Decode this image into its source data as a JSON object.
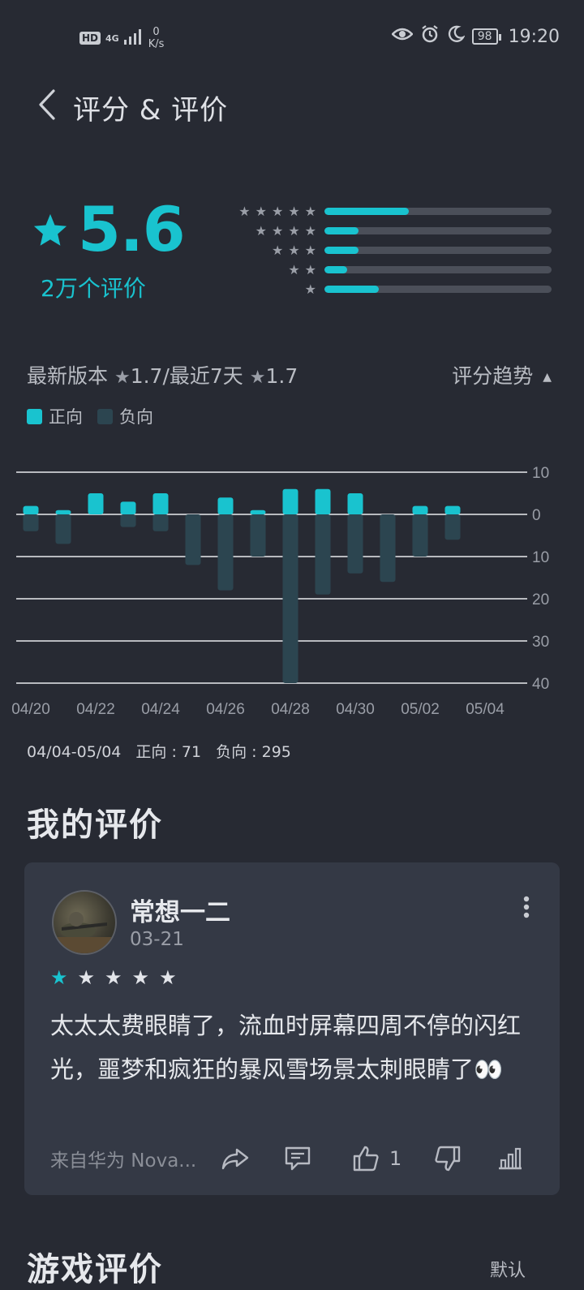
{
  "status_bar": {
    "hd": "HD",
    "network": "4G",
    "speed_value": "0",
    "speed_unit": "K/s",
    "battery": "98",
    "time": "19:20"
  },
  "header": {
    "title": "评分 & 评价"
  },
  "rating": {
    "score": "5.6",
    "count_label": "2万个评价",
    "distribution": [
      {
        "stars": 5,
        "fraction": 0.37
      },
      {
        "stars": 4,
        "fraction": 0.15
      },
      {
        "stars": 3,
        "fraction": 0.15
      },
      {
        "stars": 2,
        "fraction": 0.1
      },
      {
        "stars": 1,
        "fraction": 0.24
      }
    ]
  },
  "version_line": {
    "latest_label": "最新版本",
    "latest_score": "1.7",
    "separator": "/",
    "recent_label": "最近7天",
    "recent_score": "1.7",
    "trend_button": "评分趋势"
  },
  "legend": {
    "positive": "正向",
    "negative": "负向"
  },
  "colors": {
    "accent": "#19c3cf",
    "negative": "#2c4550",
    "card": "#343945",
    "background": "#272a33"
  },
  "chart_data": {
    "type": "bar",
    "x_ticks": [
      "04/20",
      "04/22",
      "04/24",
      "04/26",
      "04/28",
      "04/30",
      "05/02",
      "05/04"
    ],
    "y_tick_labels": [
      "10",
      "0",
      "10",
      "20",
      "30",
      "40"
    ],
    "ylim": [
      -40,
      10
    ],
    "dates": [
      "04/20",
      "04/21",
      "04/22",
      "04/23",
      "04/24",
      "04/25",
      "04/26",
      "04/27",
      "04/28",
      "04/29",
      "04/30",
      "05/01",
      "05/02",
      "05/03",
      "05/04"
    ],
    "series": [
      {
        "name": "正向",
        "values": [
          2,
          1,
          5,
          3,
          5,
          0,
          4,
          1,
          6,
          6,
          5,
          0,
          2,
          2,
          0
        ]
      },
      {
        "name": "负向",
        "values": [
          4,
          7,
          0,
          3,
          4,
          12,
          18,
          10,
          40,
          19,
          14,
          16,
          10,
          6,
          0
        ]
      }
    ]
  },
  "summary": {
    "range": "04/04-05/04",
    "positive": "正向 : 71",
    "negative": "负向 : 295"
  },
  "my_review": {
    "heading": "我的评价",
    "user": "常想一二",
    "date": "03-21",
    "stars_filled": 1,
    "stars_total": 5,
    "text": "太太太费眼睛了，流血时屏幕四周不停的闪红光，噩梦和疯狂的暴风雪场景太刺眼睛了👀",
    "source": "来自华为 Nova...",
    "like_count": "1"
  },
  "game_reviews": {
    "heading": "游戏评价",
    "sort": "默认"
  }
}
